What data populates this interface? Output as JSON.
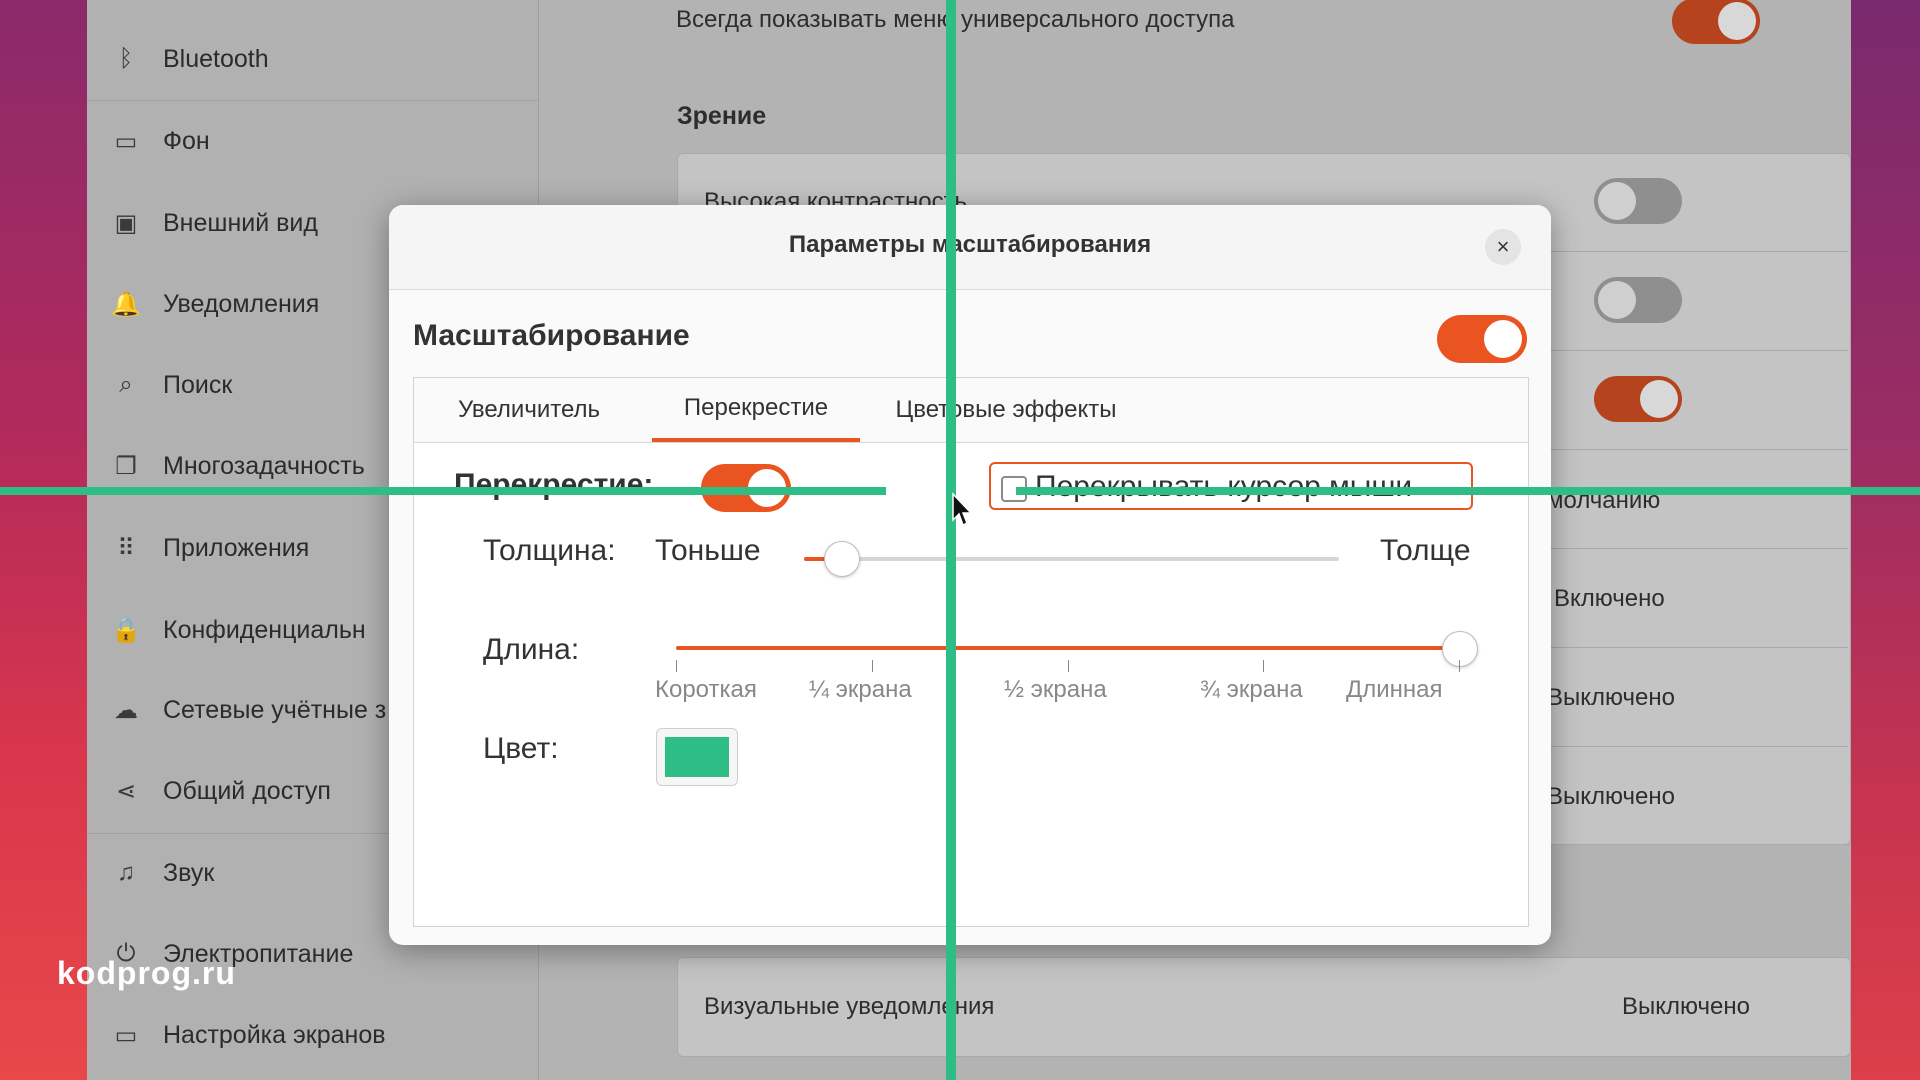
{
  "sidebar": {
    "items": [
      {
        "label": "Bluetooth",
        "icon": "bluetooth-icon",
        "glyph": "ᛒ"
      },
      {
        "label": "Фон",
        "icon": "background-icon",
        "glyph": "▭"
      },
      {
        "label": "Внешний вид",
        "icon": "appearance-icon",
        "glyph": "▣"
      },
      {
        "label": "Уведомления",
        "icon": "bell-icon",
        "glyph": "🔔"
      },
      {
        "label": "Поиск",
        "icon": "search-icon",
        "glyph": "⌕"
      },
      {
        "label": "Многозадачность",
        "icon": "multitasking-icon",
        "glyph": "❐"
      },
      {
        "label": "Приложения",
        "icon": "apps-grid-icon",
        "glyph": "⠿"
      },
      {
        "label": "Конфиденциальн",
        "icon": "lock-icon",
        "glyph": "🔒"
      },
      {
        "label": "Сетевые учётные з",
        "icon": "cloud-icon",
        "glyph": "☁"
      },
      {
        "label": "Общий доступ",
        "icon": "share-icon",
        "glyph": "⋖"
      },
      {
        "label": "Звук",
        "icon": "music-note-icon",
        "glyph": "♫"
      },
      {
        "label": "Электропитание",
        "icon": "power-icon",
        "glyph": "⏻"
      },
      {
        "label": "Настройка экранов",
        "icon": "display-icon",
        "glyph": "▭"
      }
    ]
  },
  "content": {
    "always_show_menu": "Всегда показывать меню универсального доступа",
    "vision_heading": "Зрение",
    "high_contrast": "Высокая контрастность",
    "row_values": [
      "молчанию",
      "Включено",
      "Выключено",
      "Выключено"
    ],
    "visual_alerts_label": "Визуальные уведомления",
    "visual_alerts_value": "Выключено"
  },
  "dialog": {
    "title": "Параметры масштабирования",
    "close_glyph": "×",
    "zoom_title": "Масштабирование",
    "tabs": [
      "Увеличитель",
      "Перекрестие",
      "Цветовые эффекты"
    ],
    "crosshair_label": "Перекрестие:",
    "overlap_cursor_label": "Перекрывать курсор мыши",
    "thickness_label": "Толщина:",
    "thinner": "Тоньше",
    "thicker": "Толще",
    "thickness_value": 0.07,
    "length_label": "Длина:",
    "length_ticks": [
      "Короткая",
      "¼ экрана",
      "½ экрана",
      "¾ экрана",
      "Длинная"
    ],
    "length_value": 1.0,
    "color_label": "Цвет:",
    "crosshair_color": "#2ebd85"
  },
  "colors": {
    "accent": "#e95420",
    "crosshair": "#2ebd85"
  },
  "watermark": "kodprog.ru"
}
